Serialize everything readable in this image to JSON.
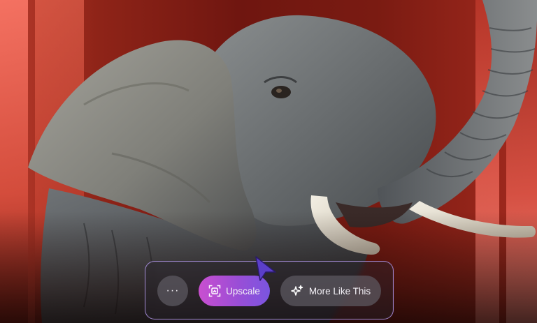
{
  "actions": {
    "more_label": "···",
    "upscale_label": "Upscale",
    "more_like_label": "More Like This"
  },
  "icons": {
    "more": "ellipsis-icon",
    "upscale": "upscale-frame-icon",
    "more_like": "sparkles-icon",
    "pointer": "cursor-arrow-icon"
  },
  "colors": {
    "accent_gradient_start": "#c94fd0",
    "accent_gradient_end": "#7a55e0",
    "bar_border": "#b296eb"
  }
}
